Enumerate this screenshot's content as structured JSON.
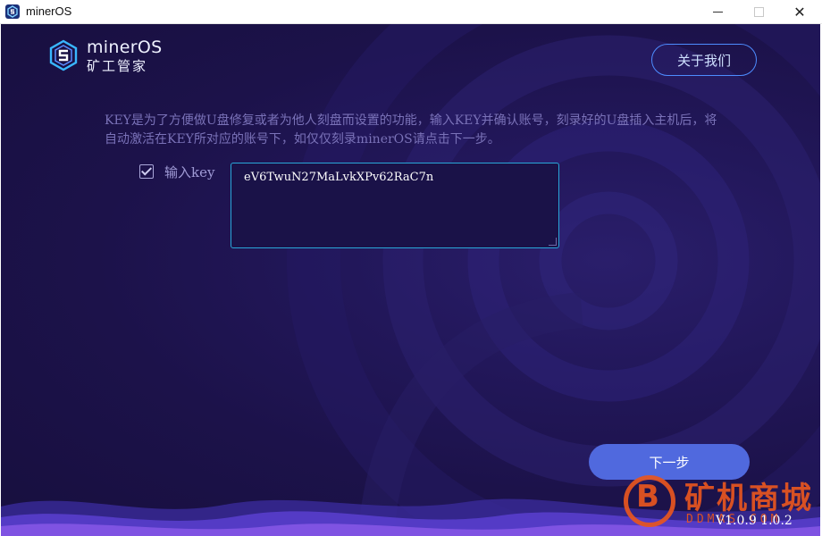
{
  "window": {
    "title": "minerOS",
    "close_glyph": "✕"
  },
  "header": {
    "logo_title": "minerOS",
    "logo_subtitle": "矿工管家",
    "about_label": "关于我们"
  },
  "main": {
    "description": "KEY是为了方便做U盘修复或者为他人刻盘而设置的功能，输入KEY并确认账号，刻录好的U盘插入主机后，将自动激活在KEY所对应的账号下，如仅仅刻录minerOS请点击下一步。",
    "key_checkbox_checked": true,
    "key_label": "输入key",
    "key_value": "eV6TwuN27MaLvkXPv62RaC7n",
    "next_label": "下一步"
  },
  "footer": {
    "version": "V1.0.9   1.0.2"
  },
  "watermark": {
    "mark": "B",
    "text": "矿机商城",
    "url": "DDMAS.COM"
  },
  "colors": {
    "background": "#1c124a",
    "accent": "#5069de",
    "input_border": "#29a7d8",
    "about_border": "#4d8cff",
    "watermark": "#e8561f"
  },
  "icons": {
    "app": "mineros-logo-icon",
    "checkbox": "checkbox-checked-icon"
  }
}
